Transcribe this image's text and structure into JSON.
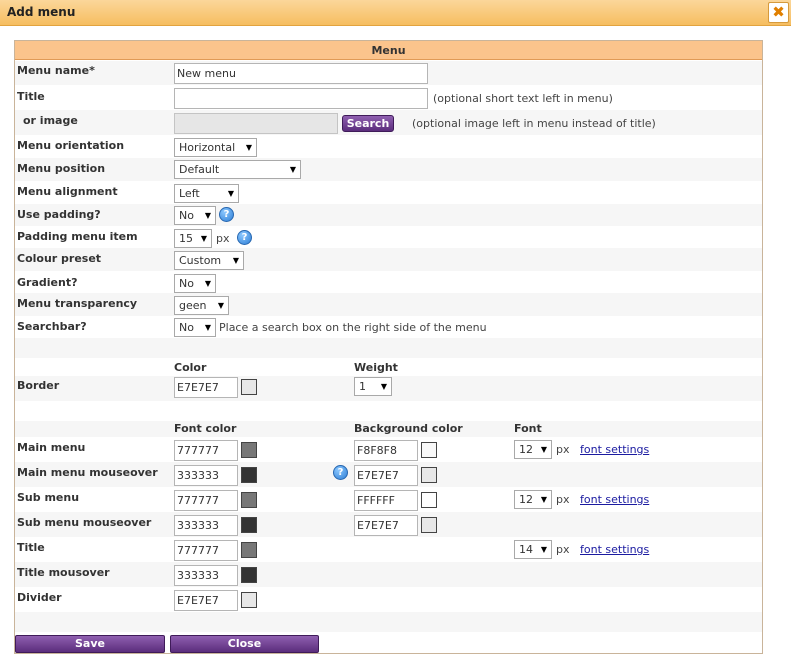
{
  "dialog": {
    "title": "Add menu",
    "close_icon": "close-icon",
    "close_glyph": "✖"
  },
  "panel": {
    "header": "Menu"
  },
  "menu_name": {
    "label": "Menu name*",
    "value": "New menu"
  },
  "title_field": {
    "label": "Title",
    "value": "",
    "hint": "(optional short text left in menu)"
  },
  "image_field": {
    "label": "or image",
    "value": "",
    "button": "Search",
    "hint": "(optional image left in menu instead of title)"
  },
  "orientation": {
    "label": "Menu orientation",
    "selected": "Horizontal"
  },
  "position": {
    "label": "Menu position",
    "selected": "Default"
  },
  "alignment": {
    "label": "Menu alignment",
    "selected": "Left"
  },
  "use_padding": {
    "label": "Use padding?",
    "selected": "No"
  },
  "padding_item": {
    "label": "Padding menu item",
    "selected": "15",
    "unit": "px"
  },
  "colour_preset": {
    "label": "Colour preset",
    "selected": "Custom"
  },
  "gradient": {
    "label": "Gradient?",
    "selected": "No"
  },
  "transparency": {
    "label": "Menu transparency",
    "selected": "geen"
  },
  "searchbar": {
    "label": "Searchbar?",
    "selected": "No",
    "hint": "Place a search box on the right side of the menu"
  },
  "help_glyph": "?",
  "arrow_glyph": "▼",
  "border_section": {
    "color_header": "Color",
    "weight_header": "Weight",
    "label": "Border",
    "color": "E7E7E7",
    "swatch": "#E7E7E7",
    "weight": "1"
  },
  "font_section": {
    "font_color_header": "Font color",
    "bg_color_header": "Background color",
    "font_header": "Font",
    "unit": "px",
    "link": "font settings",
    "rows": [
      {
        "label": "Main menu",
        "font_color": "777777",
        "font_swatch": "#777777",
        "bg_color": "F8F8F8",
        "bg_swatch": "#F8F8F8",
        "font_size": "12"
      },
      {
        "label": "Main menu mouseover",
        "font_color": "333333",
        "font_swatch": "#333333",
        "bg_color": "E7E7E7",
        "bg_swatch": "#E7E7E7"
      },
      {
        "label": "Sub menu",
        "font_color": "777777",
        "font_swatch": "#777777",
        "bg_color": "FFFFFF",
        "bg_swatch": "#FFFFFF",
        "font_size": "12"
      },
      {
        "label": "Sub menu mouseover",
        "font_color": "333333",
        "font_swatch": "#333333",
        "bg_color": "E7E7E7",
        "bg_swatch": "#E7E7E7"
      },
      {
        "label": "Title",
        "font_color": "777777",
        "font_swatch": "#777777",
        "font_size": "14"
      },
      {
        "label": "Title mousover",
        "font_color": "333333",
        "font_swatch": "#333333"
      },
      {
        "label": "Divider",
        "font_color": "E7E7E7",
        "font_swatch": "#E7E7E7"
      }
    ]
  },
  "footer": {
    "save": "Save",
    "close": "Close"
  },
  "colors": {
    "titlebar": "#F6BE60",
    "panel_header": "#FBC48C",
    "button": "#5B2D7C",
    "row_alt": "#F6F6F6"
  }
}
